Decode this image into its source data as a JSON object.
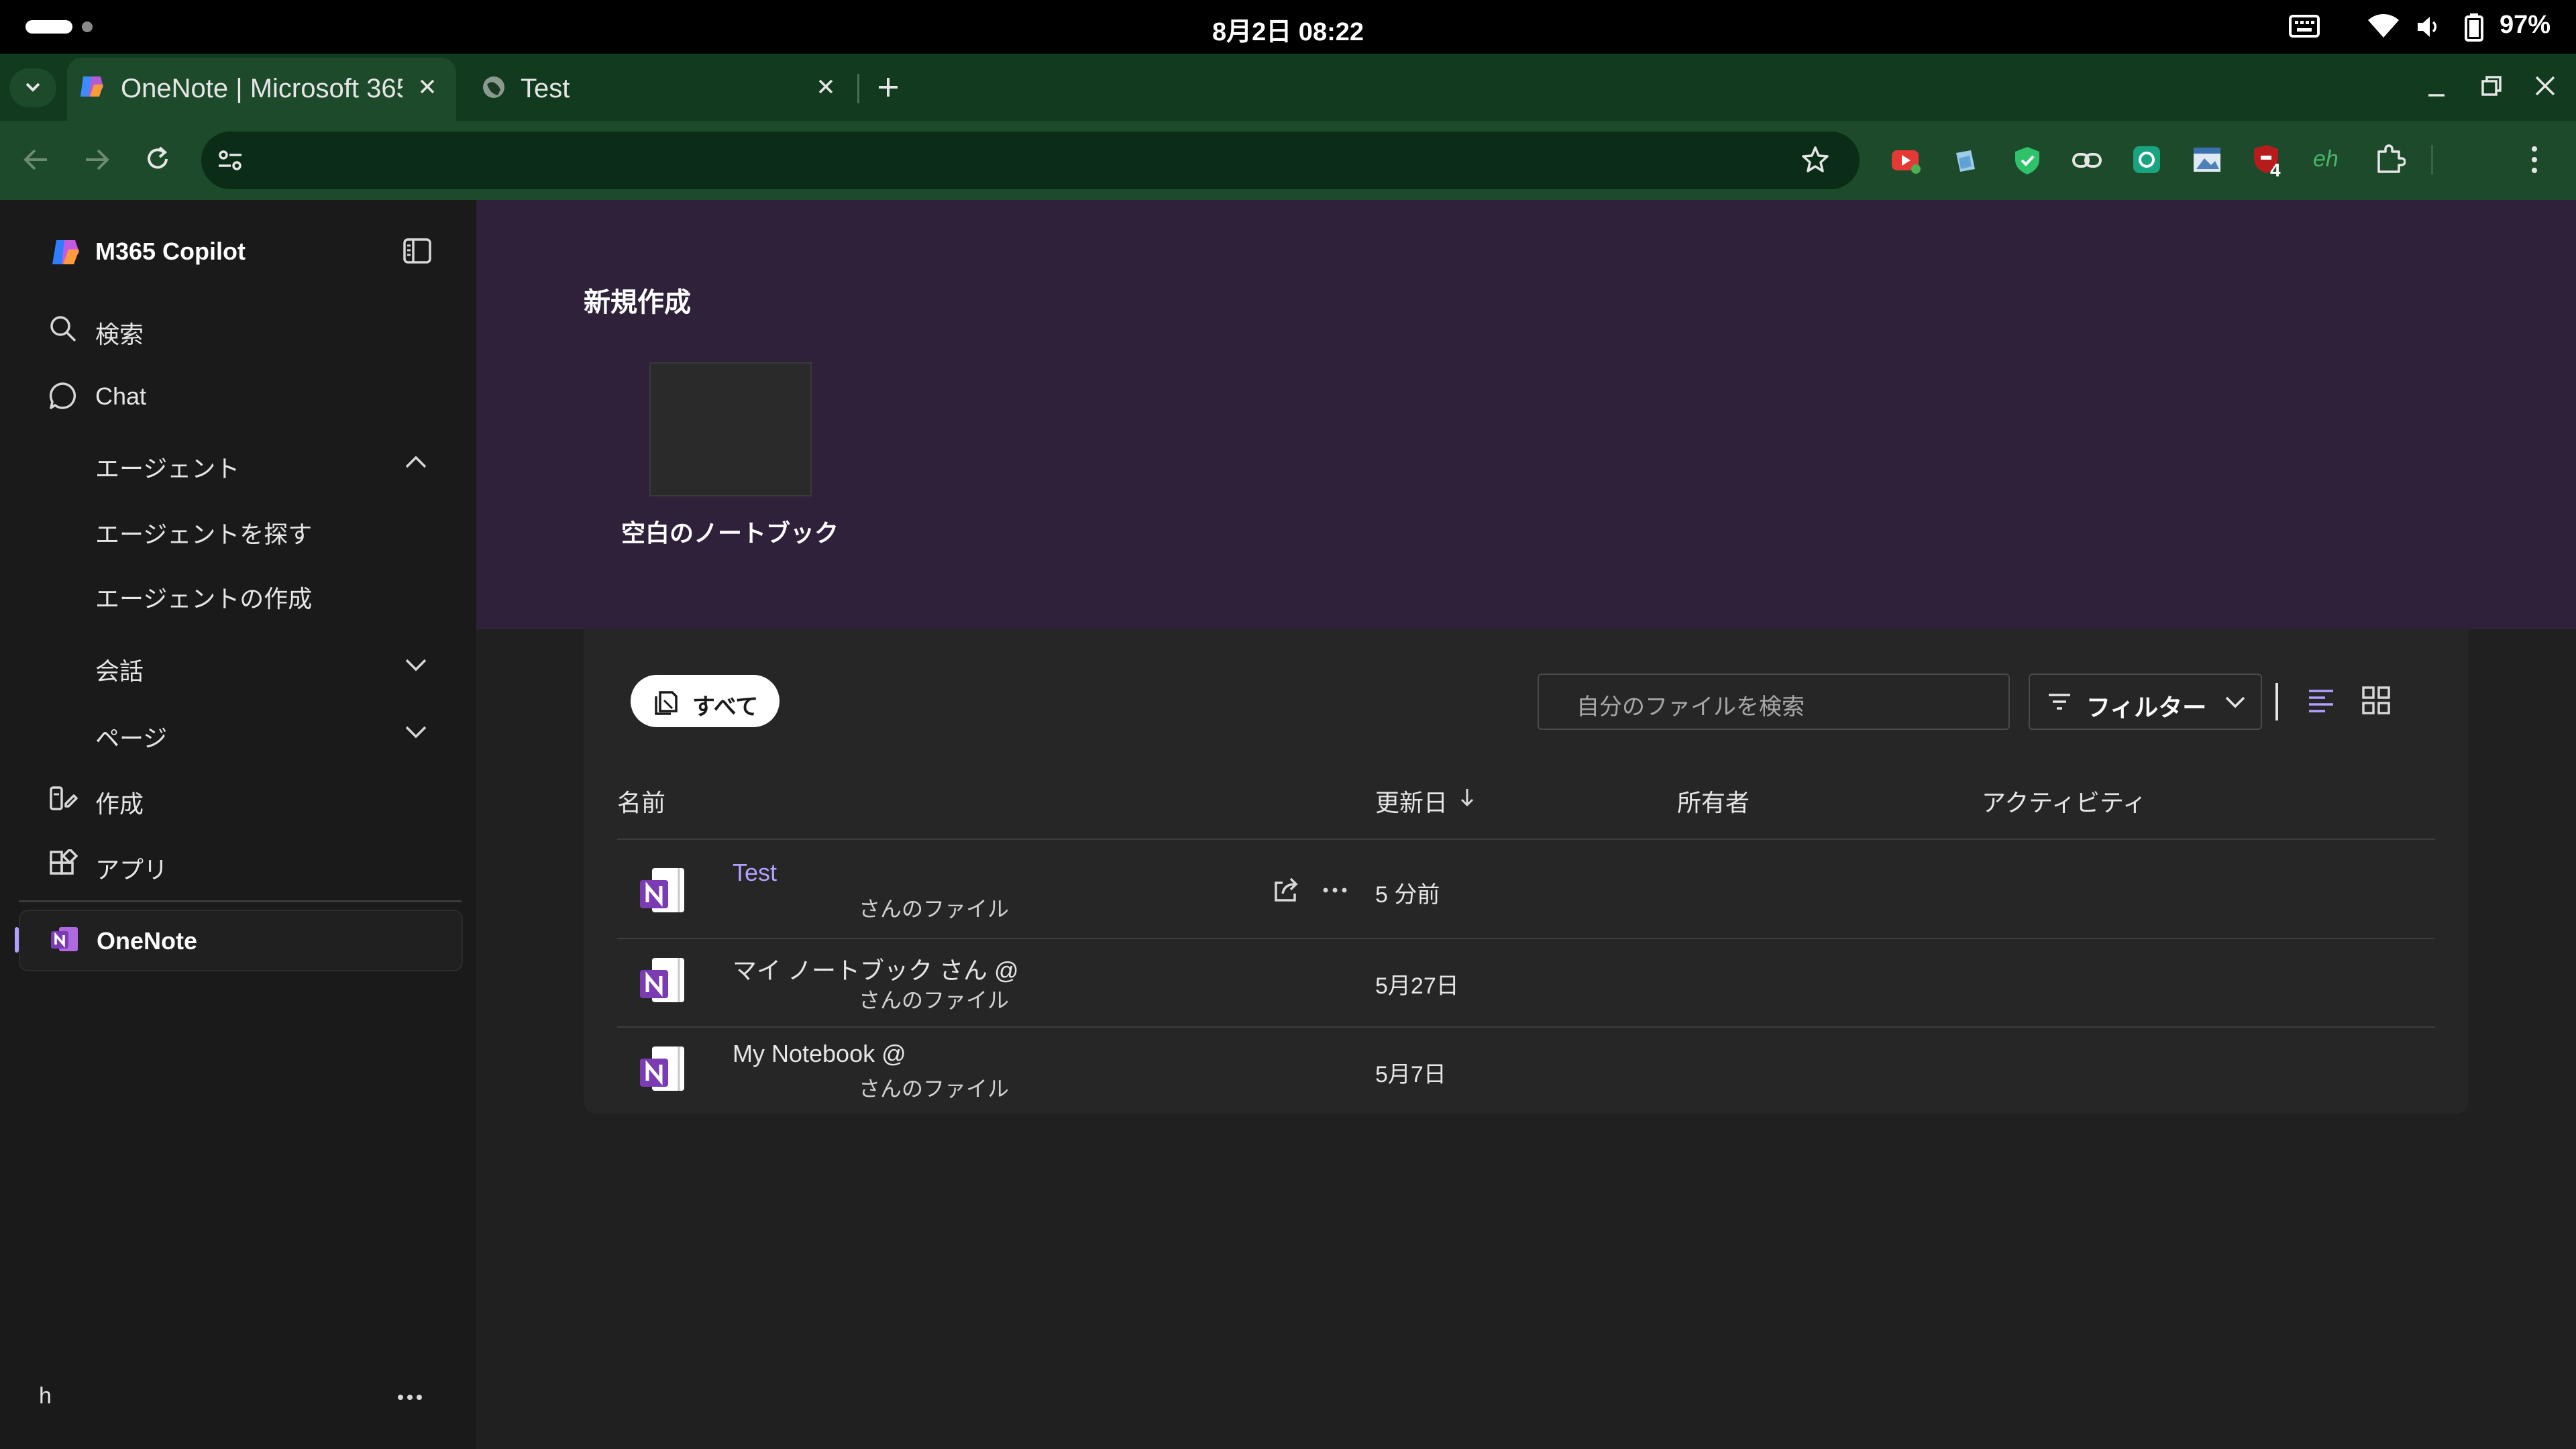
{
  "status_bar": {
    "clock": "8月2日 08:22",
    "battery": "97%"
  },
  "browser": {
    "tabs": [
      {
        "title": "OneNote | Microsoft 365",
        "active": true
      },
      {
        "title": "Test",
        "active": false
      }
    ],
    "extension_badge": "4",
    "extension_eh": "eh"
  },
  "sidebar": {
    "app_title": "M365 Copilot",
    "items": {
      "search": "検索",
      "chat": "Chat",
      "agents": "エージェント",
      "find_agents": "エージェントを探す",
      "create_agent": "エージェントの作成",
      "conversations": "会話",
      "pages": "ページ",
      "create": "作成",
      "apps": "アプリ",
      "onenote": "OneNote"
    },
    "user_initial": "h"
  },
  "main": {
    "new_section_title": "新規作成",
    "blank_notebook_label": "空白のノートブック",
    "all_button": "すべて",
    "search_placeholder": "自分のファイルを検索",
    "filter_label": "フィルター",
    "columns": {
      "name": "名前",
      "modified": "更新日",
      "owner": "所有者",
      "activity": "アクティビティ"
    },
    "files": [
      {
        "title": "Test",
        "subtitle": "さんのファイル",
        "modified": "5 分前"
      },
      {
        "title": "マイ ノートブック さん @",
        "subtitle": "さんのファイル",
        "modified": "5月27日"
      },
      {
        "title": "My Notebook @",
        "subtitle": "さんのファイル",
        "modified": "5月7日"
      }
    ]
  },
  "colors": {
    "accent": "#b4a0ff",
    "onenote_purple": "#7b3bb2",
    "hero_bg": "#30213a",
    "browser_green": "#1d4a2a"
  }
}
